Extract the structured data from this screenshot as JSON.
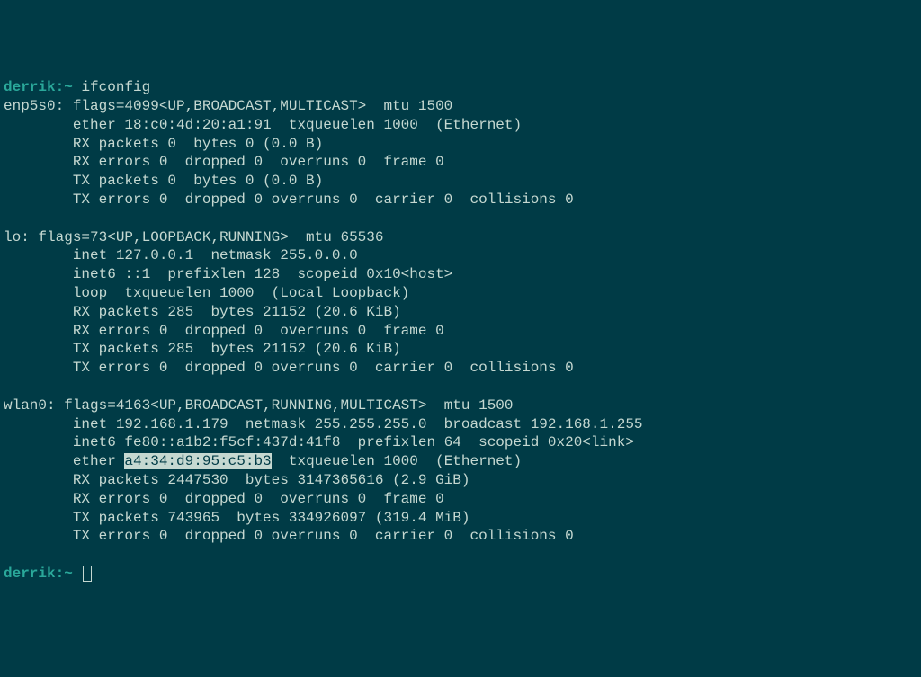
{
  "prompt1": {
    "user": "derrik",
    "sep": ":",
    "path": "~",
    "command": "ifconfig"
  },
  "if1": {
    "l1": "enp5s0: flags=4099<UP,BROADCAST,MULTICAST>  mtu 1500",
    "l2": "        ether 18:c0:4d:20:a1:91  txqueuelen 1000  (Ethernet)",
    "l3": "        RX packets 0  bytes 0 (0.0 B)",
    "l4": "        RX errors 0  dropped 0  overruns 0  frame 0",
    "l5": "        TX packets 0  bytes 0 (0.0 B)",
    "l6": "        TX errors 0  dropped 0 overruns 0  carrier 0  collisions 0"
  },
  "if2": {
    "l1": "lo: flags=73<UP,LOOPBACK,RUNNING>  mtu 65536",
    "l2": "        inet 127.0.0.1  netmask 255.0.0.0",
    "l3": "        inet6 ::1  prefixlen 128  scopeid 0x10<host>",
    "l4": "        loop  txqueuelen 1000  (Local Loopback)",
    "l5": "        RX packets 285  bytes 21152 (20.6 KiB)",
    "l6": "        RX errors 0  dropped 0  overruns 0  frame 0",
    "l7": "        TX packets 285  bytes 21152 (20.6 KiB)",
    "l8": "        TX errors 0  dropped 0 overruns 0  carrier 0  collisions 0"
  },
  "if3": {
    "l1": "wlan0: flags=4163<UP,BROADCAST,RUNNING,MULTICAST>  mtu 1500",
    "l2": "        inet 192.168.1.179  netmask 255.255.255.0  broadcast 192.168.1.255",
    "l3": "        inet6 fe80::a1b2:f5cf:437d:41f8  prefixlen 64  scopeid 0x20<link>",
    "l4a": "        ether ",
    "l4_highlight": "a4:34:d9:95:c5:b3",
    "l4b": "  txqueuelen 1000  (Ethernet)",
    "l5": "        RX packets 2447530  bytes 3147365616 (2.9 GiB)",
    "l6": "        RX errors 0  dropped 0  overruns 0  frame 0",
    "l7": "        TX packets 743965  bytes 334926097 (319.4 MiB)",
    "l8": "        TX errors 0  dropped 0 overruns 0  carrier 0  collisions 0"
  },
  "prompt2": {
    "user": "derrik",
    "sep": ":",
    "path": "~"
  }
}
